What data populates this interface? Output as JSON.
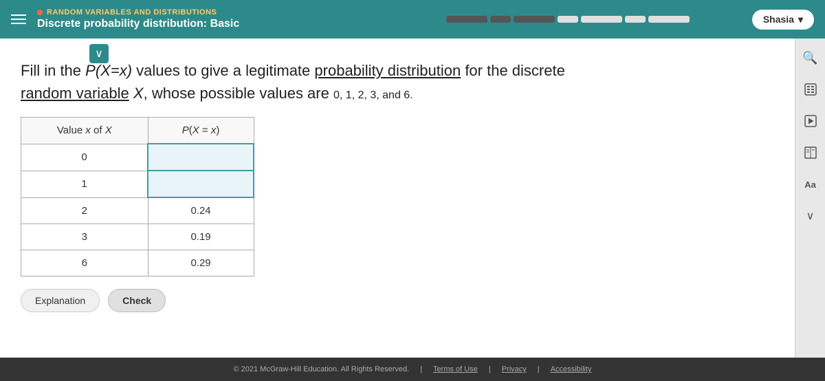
{
  "header": {
    "hamburger_label": "menu",
    "subtitle": "RANDOM VARIABLES AND DISTRIBUTIONS",
    "title": "Discrete probability distribution: Basic",
    "user_name": "Shasia"
  },
  "progress": {
    "segments": [
      {
        "filled": true,
        "width": "long"
      },
      {
        "filled": true,
        "width": "short"
      },
      {
        "filled": true,
        "width": "long"
      },
      {
        "filled": false,
        "width": "short"
      },
      {
        "filled": false,
        "width": "long"
      },
      {
        "filled": false,
        "width": "short"
      },
      {
        "filled": false,
        "width": "long"
      }
    ]
  },
  "problem": {
    "intro": "Fill in the",
    "px_notation": "P(X=x)",
    "middle": "values to give a legitimate",
    "link1": "probability distribution",
    "cont1": "for the discrete",
    "link2": "random variable",
    "var": "X,",
    "cont2": "whose possible values are",
    "values": "0, 1, 2, 3, and 6."
  },
  "table": {
    "col1_header": "Value x of X",
    "col2_header": "P(X = x)",
    "rows": [
      {
        "x": "0",
        "px": "",
        "is_input": true
      },
      {
        "x": "1",
        "px": "",
        "is_input": true
      },
      {
        "x": "2",
        "px": "0.24",
        "is_input": false
      },
      {
        "x": "3",
        "px": "0.19",
        "is_input": false
      },
      {
        "x": "6",
        "px": "0.29",
        "is_input": false
      }
    ]
  },
  "buttons": {
    "explanation": "Explanation",
    "check": "Check"
  },
  "sidebar_icons": [
    {
      "name": "search-people-icon",
      "symbol": "🔍"
    },
    {
      "name": "calculator-icon",
      "symbol": "⊞"
    },
    {
      "name": "play-icon",
      "symbol": "▷"
    },
    {
      "name": "book-icon",
      "symbol": "📖"
    },
    {
      "name": "font-icon",
      "symbol": "Aa"
    },
    {
      "name": "chevron-down-icon",
      "symbol": "∨"
    }
  ],
  "footer": {
    "copyright": "© 2021 McGraw-Hill Education. All Rights Reserved.",
    "terms": "Terms of Use",
    "privacy": "Privacy",
    "accessibility": "Accessibility"
  },
  "expand_button_label": "∨"
}
